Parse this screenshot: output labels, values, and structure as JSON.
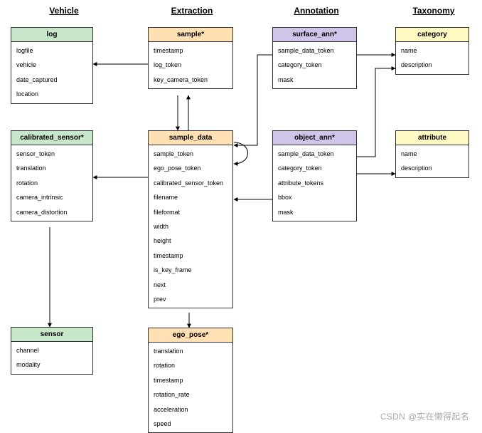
{
  "columns": {
    "vehicle": "Vehicle",
    "extraction": "Extraction",
    "annotation": "Annotation",
    "taxonomy": "Taxonomy"
  },
  "entities": {
    "log": {
      "title": "log",
      "fields": [
        "logfile",
        "vehicle",
        "date_captured",
        "location"
      ]
    },
    "calibrated_sensor": {
      "title": "calibrated_sensor*",
      "fields": [
        "sensor_token",
        "translation",
        "rotation",
        "camera_intrinsic",
        "camera_distortion"
      ]
    },
    "sensor": {
      "title": "sensor",
      "fields": [
        "channel",
        "modality"
      ]
    },
    "sample": {
      "title": "sample*",
      "fields": [
        "timestamp",
        "log_token",
        "key_camera_token"
      ]
    },
    "sample_data": {
      "title": "sample_data",
      "fields": [
        "sample_token",
        "ego_pose_token",
        "calibrated_sensor_token",
        "filename",
        "fileformat",
        "width",
        "height",
        "timestamp",
        "is_key_frame",
        "next",
        "prev"
      ]
    },
    "ego_pose": {
      "title": "ego_pose*",
      "fields": [
        "translation",
        "rotation",
        "timestamp",
        "rotation_rate",
        "acceleration",
        "speed"
      ]
    },
    "surface_ann": {
      "title": "surface_ann*",
      "fields": [
        "sample_data_token",
        "category_token",
        "mask"
      ]
    },
    "object_ann": {
      "title": "object_ann*",
      "fields": [
        "sample_data_token",
        "category_token",
        "attribute_tokens",
        "bbox",
        "mask"
      ]
    },
    "category": {
      "title": "category",
      "fields": [
        "name",
        "description"
      ]
    },
    "attribute": {
      "title": "attribute",
      "fields": [
        "name",
        "description"
      ]
    }
  },
  "watermark": "CSDN @实在懒得起名"
}
